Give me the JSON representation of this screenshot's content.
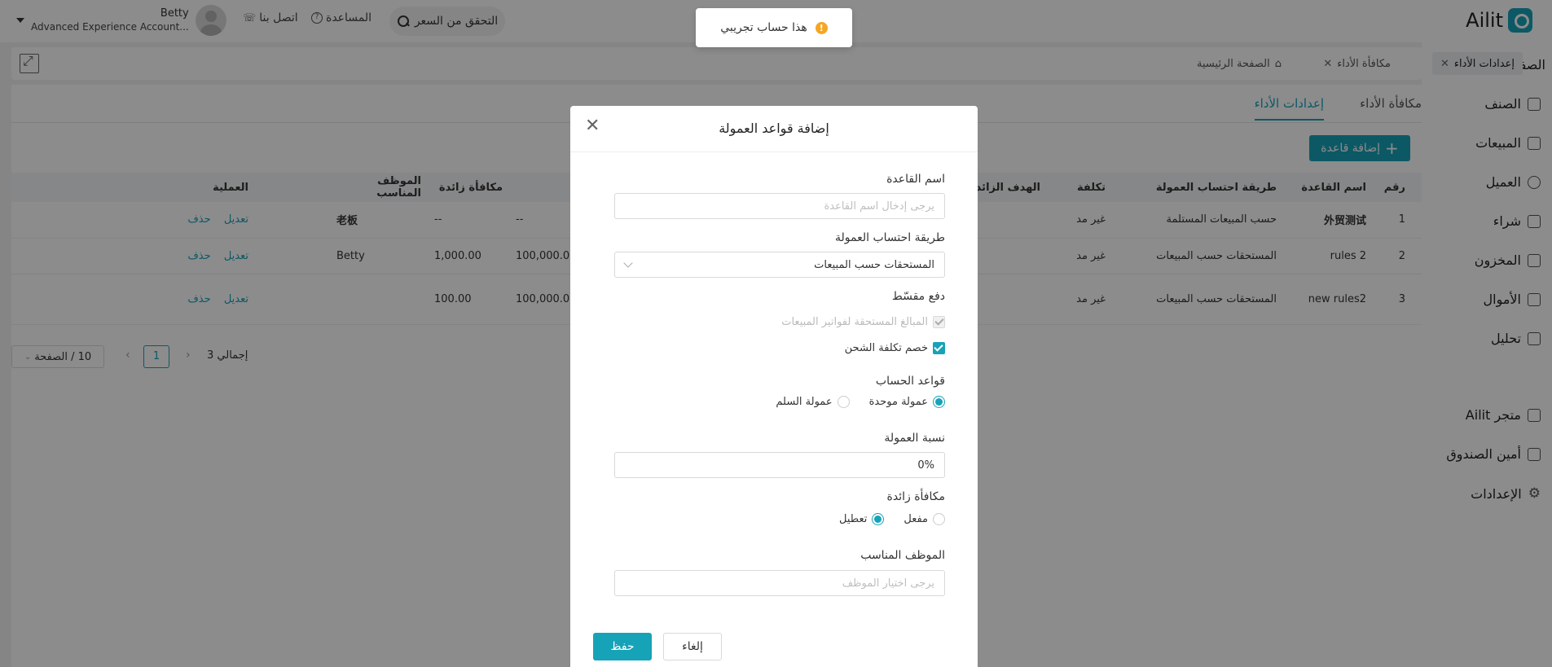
{
  "brand": {
    "name": "Ailit"
  },
  "header": {
    "price_check": "التحقق من السعر",
    "help": "المساعدة",
    "contact": "اتصل بنا",
    "user_name": "Betty",
    "user_account": "Advanced Experience Account..."
  },
  "toast": {
    "message": "هذا حساب تجريبي"
  },
  "sidebar": {
    "home": "الصفحة الرئيسية",
    "items": [
      "الصنف",
      "المبيعات",
      "العميل",
      "شراء",
      "المخزون",
      "الأموال",
      "تحليل"
    ],
    "bottom": [
      "متجر Ailit",
      "أمين الصندوق",
      "الإعدادات"
    ]
  },
  "page_tabs": [
    {
      "label": "الصفحة الرئيسية"
    },
    {
      "label": "مكافأة الأداء"
    },
    {
      "label": "إعدادات الأداء"
    }
  ],
  "sub_tabs": [
    "مكافأة الأداء",
    "إعدادات الأداء"
  ],
  "add_rule_label": "إضافة قاعدة",
  "table": {
    "headers": [
      "رقم",
      "اسم القاعدة",
      "طريقة احتساب العمولة",
      "تكلفة",
      "الهدف الزائد",
      "مكافأة زائدة",
      "الموظف المناسب",
      "العملية"
    ],
    "rows": [
      {
        "no": "1",
        "name": "外贸测试",
        "method": "حسب المبيعات المستلمة",
        "cost": "غير مد",
        "target": "--",
        "bonus": "--",
        "staff": "老板",
        "edit": "تعديل",
        "del": "حذف"
      },
      {
        "no": "2",
        "name": "rules 2",
        "method": "المستحقات حسب المبيعات",
        "cost": "غير مد",
        "target": "100,000.00",
        "bonus": "1,000.00",
        "staff": "Betty",
        "edit": "تعديل",
        "del": "حذف"
      },
      {
        "no": "3",
        "name": "new rules2",
        "method": "المستحقات حسب المبيعات",
        "cost": "غير مد",
        "target": "100,000.00",
        "bonus": "100.00",
        "staff": "",
        "edit": "تعديل",
        "del": "حذف"
      }
    ]
  },
  "pager": {
    "total": "إجمالي 3",
    "current": "1",
    "page_size": "10 / الصفحة"
  },
  "modal": {
    "title": "إضافة قواعد العمولة",
    "rule_name_label": "اسم القاعدة",
    "rule_name_placeholder": "يرجى إدخال اسم القاعدة",
    "method_label": "طريقة احتساب العمولة",
    "method_value": "المستحقات حسب المبيعات",
    "deduct_label": "دفع مقسّط",
    "chk_receivable": "المبالغ المستحقة لفواتير المبيعات",
    "chk_shipping": "خصم تكلفة الشحن",
    "calc_rules_label": "قواعد الحساب",
    "radio_unified": "عمولة موحدة",
    "radio_ladder": "عمولة السلم",
    "rate_label": "نسبة العمولة",
    "rate_value": "0%",
    "extra_bonus_label": "مكافأة زائدة",
    "radio_enabled": "مفعل",
    "radio_disabled": "تعطيل",
    "staff_label": "الموظف المناسب",
    "staff_placeholder": "يرجى اختيار الموظف",
    "save": "حفظ",
    "cancel": "إلغاء"
  },
  "colors": {
    "accent": "#16a3b8",
    "warning": "#f5a623"
  }
}
